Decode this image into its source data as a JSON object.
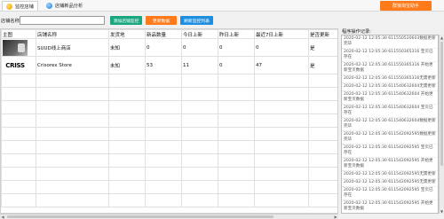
{
  "tabs": [
    {
      "label": "监控店铺",
      "icon": "monitor-icon"
    },
    {
      "label": "店铺新品分析",
      "icon": "analysis-icon"
    }
  ],
  "topright_button": "群狼淘宝助手",
  "toolbar": {
    "shop_label": "店铺名称:",
    "shop_input_value": "",
    "add_button": "添加店铺监控",
    "update_button": "更新数据",
    "refresh_button": "刷新监控列表"
  },
  "table": {
    "columns": [
      "主图",
      "店铺名称",
      "发货地",
      "新品数量",
      "今日上新",
      "昨日上新",
      "最近7日上新",
      "是否更新"
    ],
    "rows": [
      {
        "image": "thumb-1",
        "name": "SUUD线上商店",
        "location": "未知",
        "new_count": "0",
        "today": "0",
        "yesterday": "0",
        "last7": "0",
        "updated": "是"
      },
      {
        "image": "thumb-2",
        "thumb_text": "CRISS",
        "name": "Crisorex Store",
        "location": "未知",
        "new_count": "53",
        "today": "11",
        "yesterday": "0",
        "last7": "47",
        "updated": "是"
      }
    ]
  },
  "log": {
    "title": "程序操作记录:",
    "lines": [
      "2020-02-12 12:05:30 611550520603数据更新完毕",
      "2020-02-12 12:05:30 611550365316 宝贝已存在",
      "2020-02-12 12:05:30 611550365316 开始更新宝贝数据",
      "2020-02-12 12:05:30 611550365316无需更新",
      "2020-02-12 12:05:30 611540632604无需更新",
      "2020-02-12 12:05:30 611540632604 开始更新宝贝数据",
      "2020-02-12 12:05:30 611540632604 宝贝已存在",
      "2020-02-12 12:05:30 611540632604数据更新完毕",
      "2020-02-12 12:05:30 611542092595数据更新完毕",
      "2020-02-12 12:05:30 611542092595 宝贝已存在",
      "2020-02-12 12:05:30 611542092595 开始更新宝贝数据",
      "2020-02-12 12:05:30 611542092595无需更新",
      "2020-02-12 12:05:30 611542092595无需更新",
      "2020-02-12 12:05:30 611542092595 宝贝已存在",
      "2020-02-12 12:05:30 611542092595 开始更新宝贝数据",
      "2020-02-12 12:05:30 611542092595组织批量处理数据"
    ]
  },
  "colors": {
    "add": "#1aa77f",
    "update": "#ff7a1a",
    "refresh": "#1e8fe0",
    "topright": "#ff7a1a"
  }
}
